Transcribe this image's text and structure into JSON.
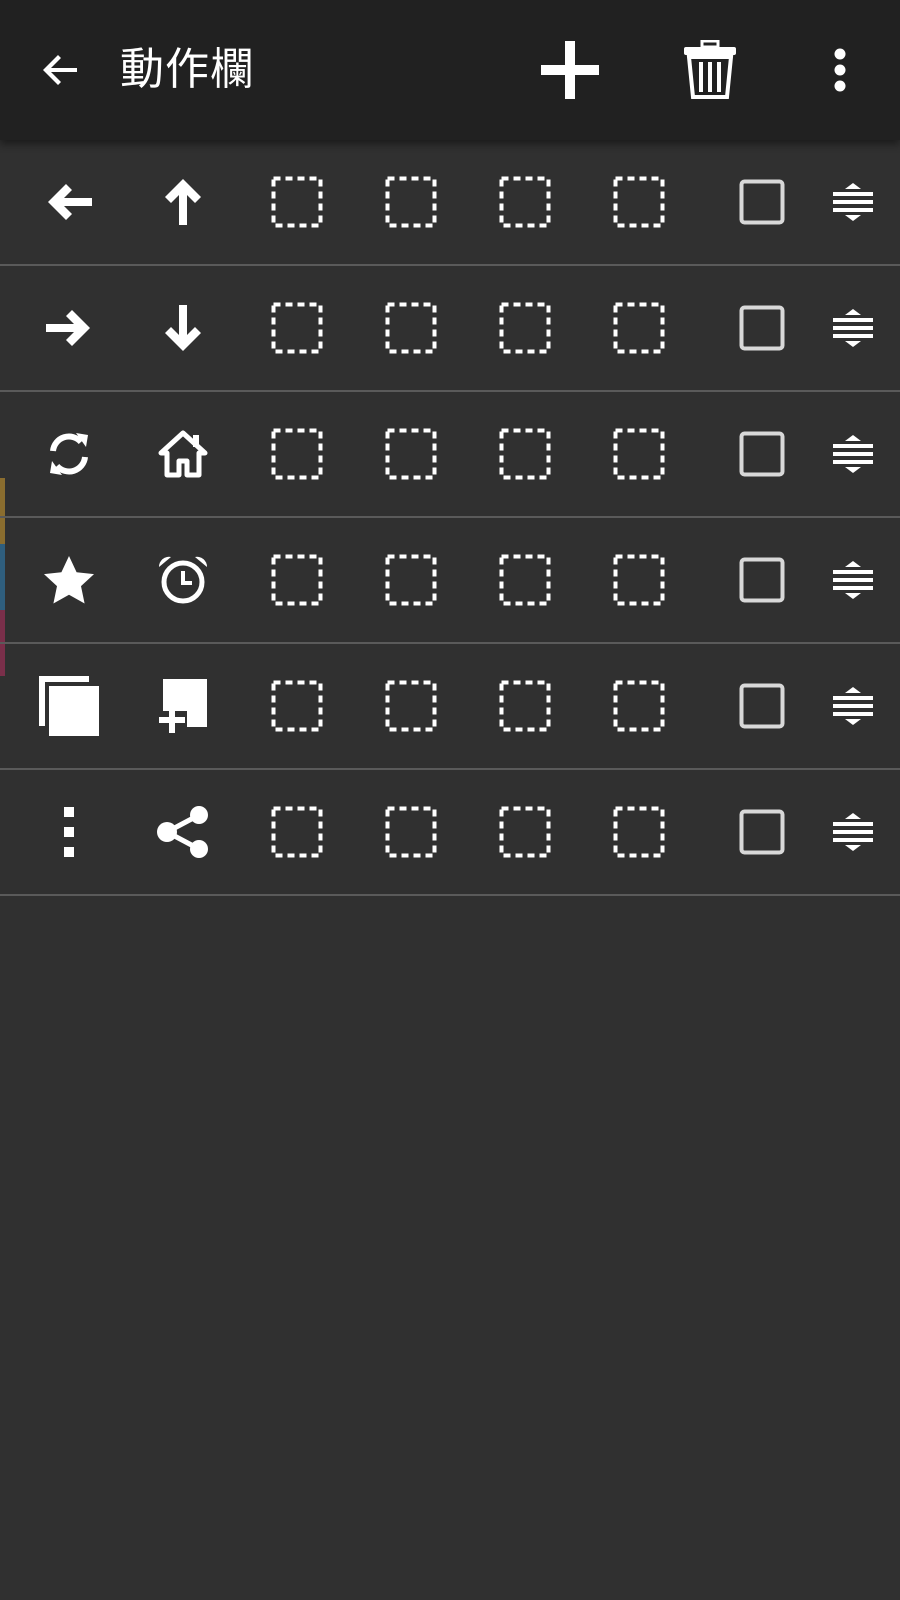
{
  "app_bar": {
    "title": "動作欄",
    "back_icon": "arrow-left-icon",
    "add_icon": "plus-icon",
    "delete_icon": "trash-icon",
    "more_icon": "more-vertical-icon"
  },
  "rows": [
    {
      "primary_icon": "arrow-left-icon",
      "secondary_icon": "arrow-up-icon",
      "empty_slots": 4,
      "checked": false
    },
    {
      "primary_icon": "arrow-right-icon",
      "secondary_icon": "arrow-down-icon",
      "empty_slots": 4,
      "checked": false
    },
    {
      "primary_icon": "refresh-icon",
      "secondary_icon": "home-icon",
      "empty_slots": 4,
      "checked": false
    },
    {
      "primary_icon": "star-icon",
      "secondary_icon": "alarm-clock-icon",
      "empty_slots": 4,
      "checked": false
    },
    {
      "primary_icon": "copy-icon",
      "secondary_icon": "add-page-icon",
      "empty_slots": 4,
      "checked": false
    },
    {
      "primary_icon": "more-vertical-icon",
      "secondary_icon": "share-icon",
      "empty_slots": 4,
      "checked": false
    }
  ],
  "colors": {
    "background": "#303030",
    "app_bar": "#212121",
    "icon": "#ffffff",
    "divider": "#5a5a5a",
    "edge_accent_1": "#8a6d2f",
    "edge_accent_2": "#2f5e7d",
    "edge_accent_3": "#7a2f4a"
  }
}
